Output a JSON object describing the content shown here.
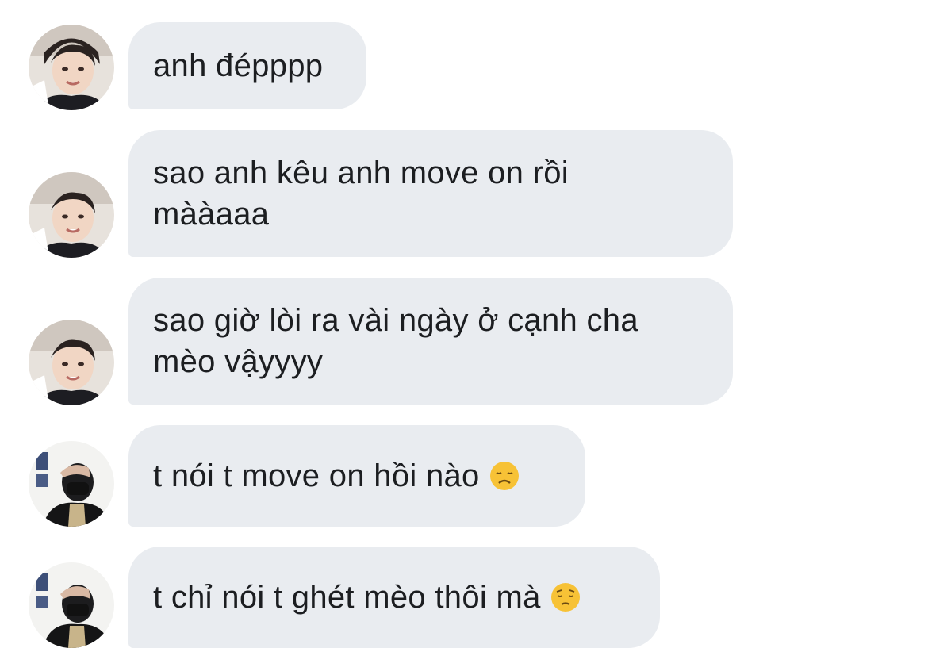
{
  "thread": {
    "messages": [
      {
        "sender": "avatar-a",
        "text": "anh đépppp"
      },
      {
        "sender": "avatar-a",
        "text": "sao anh kêu anh move on rồi\nmààaaa"
      },
      {
        "sender": "avatar-a",
        "text": "sao giờ lòi ra vài ngày ở cạnh cha\nmèo vậyyyy"
      },
      {
        "sender": "avatar-b",
        "text": "t nói t move on hồi nào",
        "emoji": "disappointed-face-icon"
      },
      {
        "sender": "avatar-b",
        "text": "t chỉ nói t ghét mèo thôi mà",
        "emoji": "pensive-face-icon"
      }
    ]
  },
  "colors": {
    "bubble_bg": "#e9ecf0",
    "text": "#1c1e21",
    "emoji_face": "#f7c236"
  }
}
